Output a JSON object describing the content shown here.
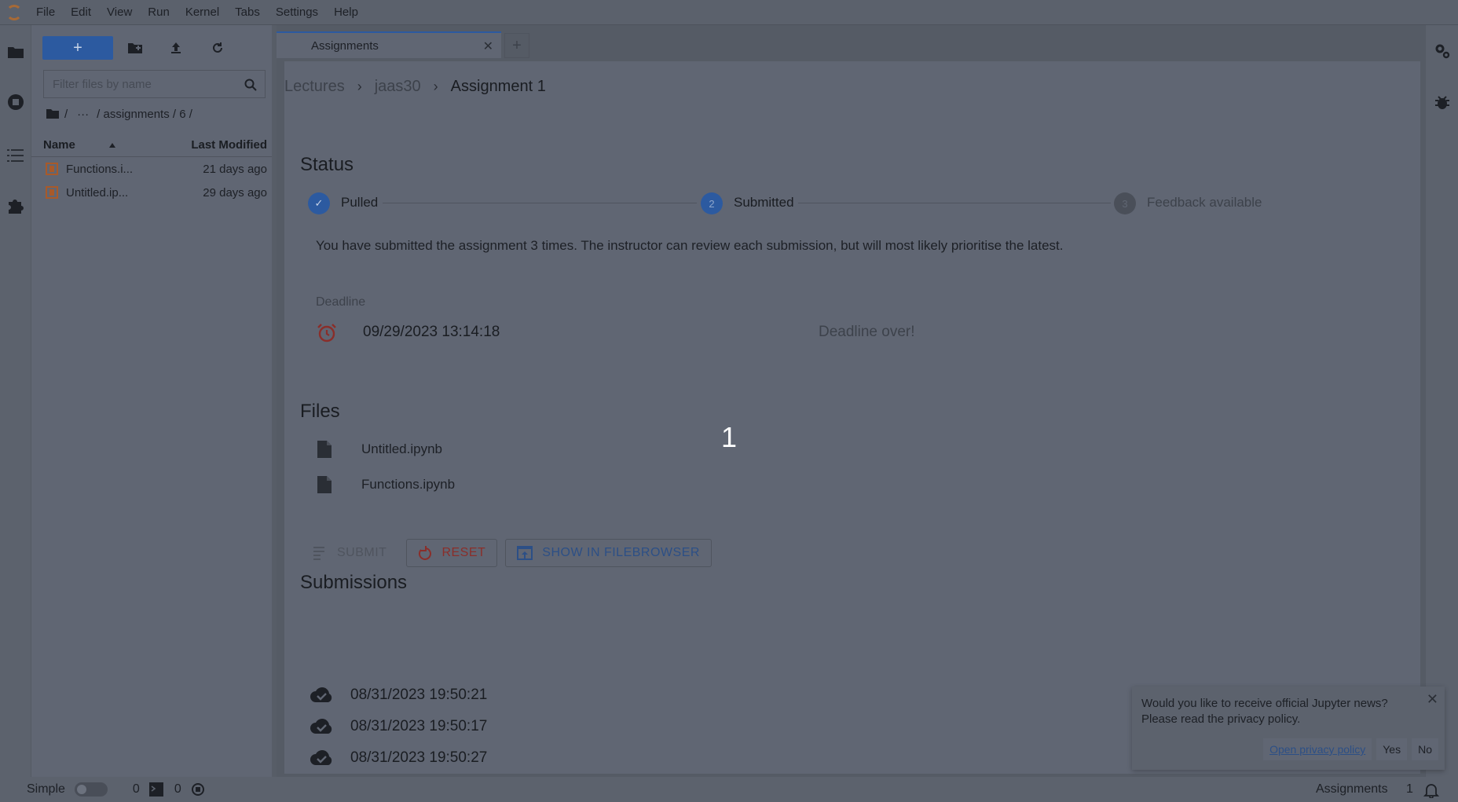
{
  "menubar": {
    "items": [
      "File",
      "Edit",
      "View",
      "Run",
      "Kernel",
      "Tabs",
      "Settings",
      "Help"
    ]
  },
  "filebrowser": {
    "new_label": "+",
    "filter_placeholder": "Filter files by name",
    "path_root": "/",
    "path_ellipsis": "···",
    "path_rest": "/ assignments / 6 /",
    "col_name": "Name",
    "col_modified": "Last Modified",
    "files": [
      {
        "name": "Functions.i...",
        "modified": "21 days ago"
      },
      {
        "name": "Untitled.ip...",
        "modified": "29 days ago"
      }
    ]
  },
  "tabs": {
    "active_label": "Assignments",
    "add_label": "+"
  },
  "breadcrumb": {
    "items": [
      "Lectures",
      "jaas30",
      "Assignment 1"
    ],
    "separator": "›"
  },
  "status": {
    "title": "Status",
    "steps": [
      {
        "label": "Pulled",
        "marker": "✓",
        "state": "done"
      },
      {
        "label": "Submitted",
        "marker": "2",
        "state": "active"
      },
      {
        "label": "Feedback available",
        "marker": "3",
        "state": "pending"
      }
    ],
    "message": "You have submitted the assignment 3 times. The instructor can review each submission, but will most likely prioritise the latest.",
    "deadline_label": "Deadline",
    "deadline_value": "09/29/2023 13:14:18",
    "deadline_status": "Deadline over!"
  },
  "files": {
    "title": "Files",
    "items": [
      "Untitled.ipynb",
      "Functions.ipynb"
    ]
  },
  "actions": {
    "submit": "SUBMIT",
    "reset": "RESET",
    "show": "SHOW IN FILEBROWSER"
  },
  "submissions": {
    "title": "Submissions",
    "items": [
      "08/31/2023 19:50:21",
      "08/31/2023 19:50:17",
      "08/31/2023 19:50:27"
    ]
  },
  "overlay": {
    "number": "1"
  },
  "statusbar": {
    "mode_label": "Simple",
    "terminals": "0",
    "kernels": "0",
    "right_label": "Assignments",
    "right_count": "1"
  },
  "notification": {
    "message": "Would you like to receive official Jupyter news? Please read the privacy policy.",
    "link": "Open privacy policy",
    "yes": "Yes",
    "no": "No"
  },
  "colors": {
    "accent": "#2c5aa0",
    "danger": "#8a2e2a",
    "background": "#606673"
  }
}
